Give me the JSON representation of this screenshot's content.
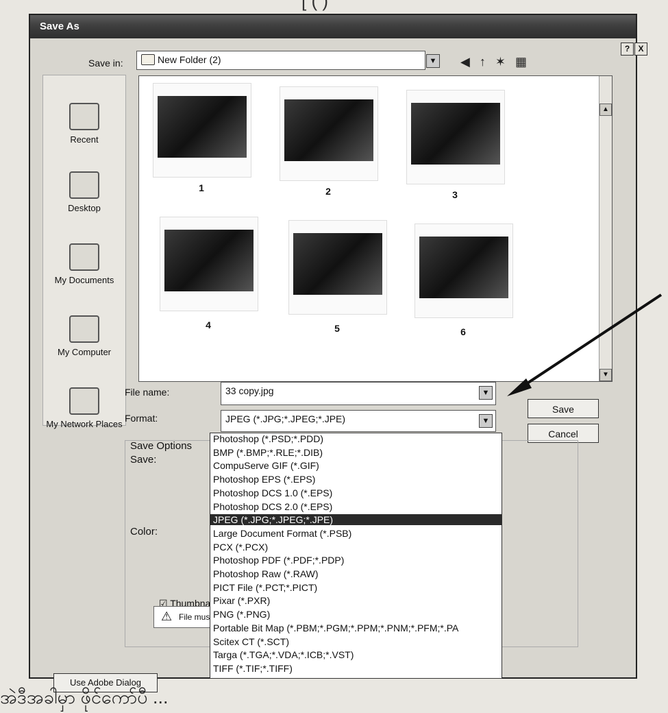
{
  "top_snippet": "[ ( )",
  "bottom_snippet": "အဲဒီအခါမှာ ဖိုင်ကော်ပီ ...",
  "dialog": {
    "title": "Save As",
    "help_button": "?",
    "close_button": "X",
    "save_in": {
      "label": "Save in:",
      "value": "New Folder (2)"
    },
    "places": [
      "Recent",
      "Desktop",
      "My Documents",
      "My Computer",
      "My Network Places"
    ],
    "thumbnails": [
      "1",
      "2",
      "3",
      "4",
      "5",
      "6"
    ],
    "file_name": {
      "label": "File name:",
      "value": "33 copy.jpg"
    },
    "format": {
      "label": "Format:",
      "value": "JPEG (*.JPG;*.JPEG;*.JPE)"
    },
    "buttons": {
      "save": "Save",
      "cancel": "Cancel",
      "use_adobe": "Use Adobe Dialog"
    },
    "save_options": {
      "title": "Save Options",
      "save_label": "Save:",
      "color_label": "Color:",
      "thumbnail_label": "Thumbnail",
      "warning_text": "File must be"
    },
    "format_options": [
      "Photoshop (*.PSD;*.PDD)",
      "BMP (*.BMP;*.RLE;*.DIB)",
      "CompuServe GIF (*.GIF)",
      "Photoshop EPS (*.EPS)",
      "Photoshop DCS 1.0 (*.EPS)",
      "Photoshop DCS 2.0 (*.EPS)",
      "JPEG (*.JPG;*.JPEG;*.JPE)",
      "Large Document Format (*.PSB)",
      "PCX (*.PCX)",
      "Photoshop PDF (*.PDF;*.PDP)",
      "Photoshop Raw (*.RAW)",
      "PICT File (*.PCT;*.PICT)",
      "Pixar (*.PXR)",
      "PNG (*.PNG)",
      "Portable Bit Map (*.PBM;*.PGM;*.PPM;*.PNM;*.PFM;*.PA",
      "Scitex CT (*.SCT)",
      "Targa (*.TGA;*.VDA;*.ICB;*.VST)",
      "TIFF (*.TIF;*.TIFF)"
    ],
    "selected_format_index": 6
  }
}
